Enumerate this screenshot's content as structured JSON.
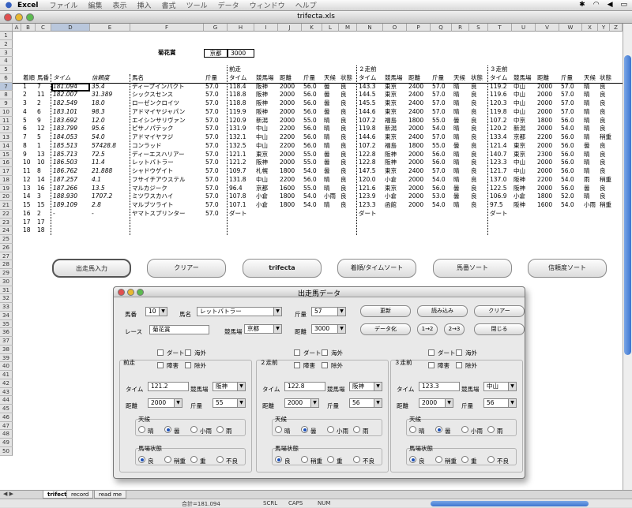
{
  "menubar": {
    "app": "Excel",
    "items": [
      "ファイル",
      "編集",
      "表示",
      "挿入",
      "書式",
      "ツール",
      "データ",
      "ウィンドウ",
      "ヘルプ"
    ]
  },
  "window": {
    "title": "trifecta.xls"
  },
  "sheet": {
    "columns": [
      "A",
      "B",
      "C",
      "D",
      "E",
      "F",
      "G",
      "H",
      "I",
      "J",
      "K",
      "L",
      "M",
      "N",
      "O",
      "P",
      "Q",
      "R",
      "S",
      "T",
      "U",
      "V",
      "W",
      "X",
      "Y",
      "Z"
    ],
    "rows": [
      "1",
      "2",
      "3",
      "4",
      "5",
      "6",
      "7",
      "8",
      "9",
      "10",
      "11",
      "12",
      "13",
      "14",
      "15",
      "16",
      "17",
      "18",
      "19",
      "20",
      "21",
      "22",
      "23",
      "24",
      "25",
      "26",
      "27",
      "28",
      "29",
      "30",
      "31",
      "32",
      "33",
      "34",
      "35",
      "36",
      "37",
      "38",
      "39",
      "40",
      "41",
      "42",
      "43",
      "44",
      "45",
      "46",
      "47",
      "48",
      "49",
      "50"
    ],
    "race_name": "菊花賞",
    "race_venue": "京都",
    "race_distance": "3000",
    "sec_prev1": "前走",
    "sec_prev2": "２走前",
    "sec_prev3": "３走前",
    "headers": [
      "着順",
      "馬番",
      "タイム",
      "信頼度",
      "馬名",
      "斤量",
      "タイム",
      "競馬場",
      "距離",
      "斤量",
      "天候",
      "状態",
      "タイム",
      "競馬場",
      "距離",
      "斤量",
      "天候",
      "状態",
      "タイム",
      "競馬場",
      "距離",
      "斤量",
      "天候",
      "状態"
    ],
    "data": [
      [
        "1",
        "7",
        "181.094",
        "35.4",
        "ディープインパクト",
        "57.0",
        "118.4",
        "阪神",
        "2000",
        "56.0",
        "曇",
        "良",
        "143.3",
        "東京",
        "2400",
        "57.0",
        "晴",
        "良",
        "119.2",
        "中山",
        "2000",
        "57.0",
        "晴",
        "良"
      ],
      [
        "2",
        "11",
        "182.007",
        "31.389",
        "シックスセンス",
        "57.0",
        "118.8",
        "阪神",
        "2000",
        "56.0",
        "曇",
        "良",
        "144.5",
        "東京",
        "2400",
        "57.0",
        "晴",
        "良",
        "119.6",
        "中山",
        "2000",
        "57.0",
        "晴",
        "良"
      ],
      [
        "3",
        "2",
        "182.549",
        "18.0",
        "ローゼンクロイツ",
        "57.0",
        "118.8",
        "阪神",
        "2000",
        "56.0",
        "曇",
        "良",
        "145.5",
        "東京",
        "2400",
        "57.0",
        "晴",
        "良",
        "120.3",
        "中山",
        "2000",
        "57.0",
        "晴",
        "良"
      ],
      [
        "4",
        "6",
        "183.101",
        "98.3",
        "アドマイヤジャパン",
        "57.0",
        "119.9",
        "阪神",
        "2000",
        "56.0",
        "曇",
        "良",
        "144.6",
        "東京",
        "2400",
        "57.0",
        "晴",
        "良",
        "119.8",
        "中山",
        "2000",
        "57.0",
        "晴",
        "良"
      ],
      [
        "5",
        "9",
        "183.692",
        "12.0",
        "エイシンサリヴァン",
        "57.0",
        "120.9",
        "新潟",
        "2000",
        "55.0",
        "晴",
        "良",
        "107.2",
        "福島",
        "1800",
        "55.0",
        "曇",
        "良",
        "107.2",
        "中京",
        "1800",
        "56.0",
        "晴",
        "良"
      ],
      [
        "6",
        "12",
        "183.799",
        "95.6",
        "ピサノパテック",
        "57.0",
        "131.9",
        "中山",
        "2200",
        "56.0",
        "晴",
        "良",
        "119.8",
        "新潟",
        "2000",
        "54.0",
        "晴",
        "良",
        "120.2",
        "新潟",
        "2000",
        "54.0",
        "晴",
        "良"
      ],
      [
        "7",
        "5",
        "184.053",
        "54.0",
        "アドマイヤフジ",
        "57.0",
        "132.1",
        "中山",
        "2200",
        "56.0",
        "晴",
        "良",
        "144.6",
        "東京",
        "2400",
        "57.0",
        "晴",
        "良",
        "133.4",
        "京都",
        "2200",
        "56.0",
        "晴",
        "稍重"
      ],
      [
        "8",
        "1",
        "185.513",
        "57428.8",
        "コンラッド",
        "57.0",
        "132.5",
        "中山",
        "2200",
        "56.0",
        "晴",
        "良",
        "107.2",
        "福島",
        "1800",
        "55.0",
        "曇",
        "良",
        "121.4",
        "東京",
        "2000",
        "56.0",
        "曇",
        "良"
      ],
      [
        "9",
        "13",
        "185.713",
        "72.5",
        "ディーエスハリアー",
        "57.0",
        "121.1",
        "東京",
        "2000",
        "55.0",
        "曇",
        "良",
        "122.8",
        "阪神",
        "2000",
        "56.0",
        "晴",
        "良",
        "140.7",
        "東京",
        "2300",
        "56.0",
        "晴",
        "良"
      ],
      [
        "10",
        "10",
        "186.503",
        "11.4",
        "レットバトラー",
        "57.0",
        "121.2",
        "阪神",
        "2000",
        "55.0",
        "曇",
        "良",
        "122.8",
        "阪神",
        "2000",
        "56.0",
        "晴",
        "良",
        "123.3",
        "中山",
        "2000",
        "56.0",
        "晴",
        "良"
      ],
      [
        "11",
        "8",
        "186.762",
        "21.888",
        "シャドウゲイト",
        "57.0",
        "109.7",
        "札幌",
        "1800",
        "54.0",
        "曇",
        "良",
        "147.5",
        "東京",
        "2400",
        "57.0",
        "晴",
        "良",
        "121.7",
        "中山",
        "2000",
        "56.0",
        "晴",
        "良"
      ],
      [
        "12",
        "14",
        "187.257",
        "4.1",
        "フサイチアウステル",
        "57.0",
        "131.8",
        "中山",
        "2200",
        "56.0",
        "晴",
        "良",
        "120.0",
        "小倉",
        "2000",
        "54.0",
        "晴",
        "良",
        "137.0",
        "阪神",
        "2200",
        "54.0",
        "雨",
        "稍重"
      ],
      [
        "13",
        "16",
        "187.266",
        "13.5",
        "マルカジーク",
        "57.0",
        "96.4",
        "京都",
        "1600",
        "55.0",
        "晴",
        "良",
        "121.6",
        "東京",
        "2000",
        "56.0",
        "曇",
        "良",
        "122.5",
        "阪神",
        "2000",
        "56.0",
        "曇",
        "良"
      ],
      [
        "14",
        "3",
        "188.930",
        "1707.2",
        "ミツワスカハイ",
        "57.0",
        "107.8",
        "小倉",
        "1800",
        "54.0",
        "小雨",
        "良",
        "123.9",
        "小倉",
        "2000",
        "53.0",
        "曇",
        "良",
        "106.9",
        "小倉",
        "1800",
        "52.0",
        "晴",
        "良"
      ],
      [
        "15",
        "15",
        "189.109",
        "2.8",
        "マルブツライト",
        "57.0",
        "107.1",
        "小倉",
        "1800",
        "54.0",
        "晴",
        "良",
        "123.3",
        "函館",
        "2000",
        "54.0",
        "晴",
        "良",
        "97.5",
        "阪神",
        "1600",
        "54.0",
        "小雨",
        "稍重"
      ],
      [
        "16",
        "2",
        "-",
        "-",
        "ヤマトスプリンター",
        "57.0",
        "ダート",
        "",
        "",
        "",
        "",
        "",
        "ダート",
        "",
        "",
        "",
        "",
        "",
        "ダート",
        "",
        "",
        "",
        "",
        ""
      ],
      [
        "17",
        "17",
        "",
        "",
        "",
        "",
        "",
        "",
        "",
        "",
        "",
        "",
        "",
        "",
        "",
        "",
        "",
        "",
        "",
        "",
        "",
        "",
        "",
        ""
      ],
      [
        "18",
        "18",
        "",
        "",
        "",
        "",
        "",
        "",
        "",
        "",
        "",
        "",
        "",
        "",
        "",
        "",
        "",
        "",
        "",
        "",
        "",
        "",
        "",
        ""
      ]
    ],
    "buttons": [
      "出走馬入力",
      "クリアー",
      "trifecta",
      "着順/タイムソート",
      "馬番ソート",
      "信頼度ソート"
    ],
    "tabs": [
      "trifecta",
      "record",
      "read me"
    ],
    "status": {
      "sum": "合計=181.094",
      "scrl": "SCRL",
      "caps": "CAPS",
      "num": "NUM"
    }
  },
  "dialog": {
    "title": "出走馬データ",
    "umaban_label": "馬番",
    "umaban": "10",
    "horse_label": "馬名",
    "horse": "レットバトラー",
    "kinryo_label": "斤量",
    "kinryo": "57",
    "race_label": "レース",
    "race": "菊花賞",
    "course_label": "競馬場",
    "course": "京都",
    "dist_label": "距離",
    "dist": "3000",
    "btn_update": "更新",
    "btn_load": "読み込み",
    "btn_clear": "クリアー",
    "btn_data": "データ化",
    "btn_12": "1→2",
    "btn_23": "2→3",
    "btn_close": "閉じる",
    "sections": [
      {
        "title": "前走",
        "time": "121.2",
        "course": "阪神",
        "dist": "2000",
        "kinryo": "55",
        "weather": "曇",
        "track": "良"
      },
      {
        "title": "２走前",
        "time": "122.8",
        "course": "阪神",
        "dist": "2000",
        "kinryo": "56",
        "weather": "曇",
        "track": "良"
      },
      {
        "title": "３走前",
        "time": "123.3",
        "course": "中山",
        "dist": "2000",
        "kinryo": "56",
        "weather": "曇",
        "track": "良"
      }
    ],
    "chk_dirt": "ダート",
    "chk_kaigai": "海外",
    "chk_shogai": "障害",
    "chk_jogai": "除外",
    "lbl_time": "タイム",
    "lbl_course": "競馬場",
    "lbl_dist": "距離",
    "lbl_kinryo": "斤量",
    "weather_label": "天候",
    "weather_opts": [
      "晴",
      "曇",
      "小雨",
      "雨"
    ],
    "track_label": "馬場状態",
    "track_opts": [
      "良",
      "稍重",
      "重",
      "不良"
    ]
  }
}
